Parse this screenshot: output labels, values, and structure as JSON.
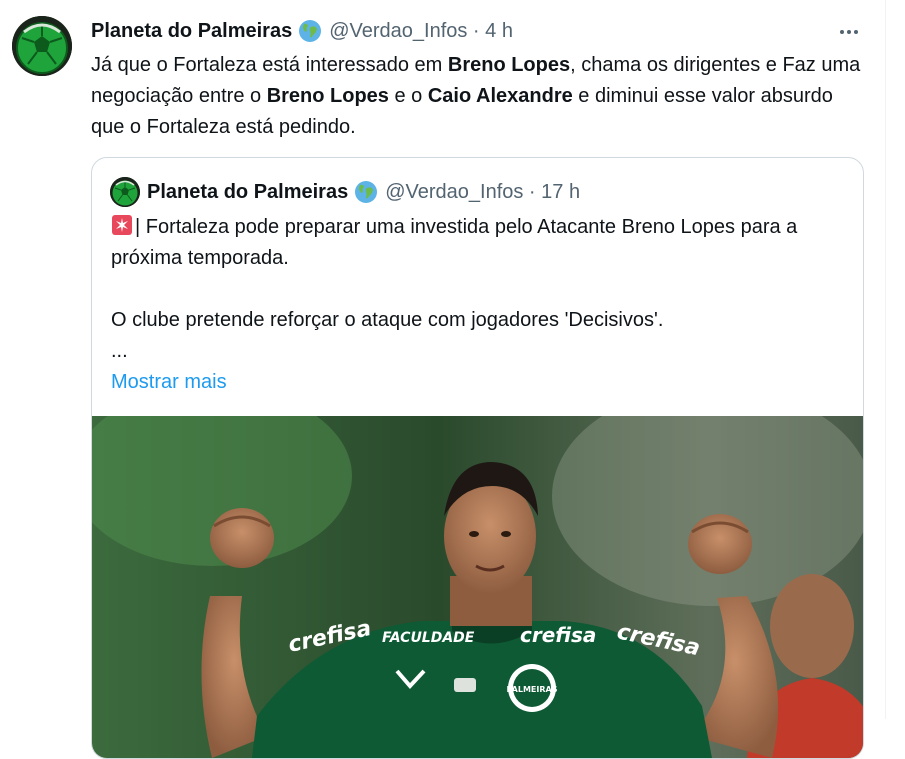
{
  "tweet": {
    "author_name": "Planeta do Palmeiras",
    "handle_time": "@Verdao_Infos · 4 h",
    "text_parts": {
      "p1": "Já que o Fortaleza está interessado em ",
      "b1": "Breno Lopes",
      "p2": ", chama os dirigentes e Faz uma negociação entre o ",
      "b2": "Breno Lopes",
      "p3": " e o ",
      "b3": "Caio Alexandre",
      "p4": " e diminui esse valor absurdo que o Fortaleza está pedindo."
    }
  },
  "quoted": {
    "author_name": "Planeta do Palmeiras",
    "handle_time": "@Verdao_Infos · 17 h",
    "line1": "| Fortaleza pode preparar uma investida pelo Atacante Breno Lopes para a próxima temporada.",
    "line2": "O clube pretende reforçar o ataque com jogadores 'Decisivos'.",
    "ellipsis": "...",
    "show_more": "Mostrar mais",
    "photo": {
      "jersey_text_left": "crefisa",
      "jersey_text_right": "crefisa",
      "jersey_text_center": "crefisa",
      "sponsor_chest": "FACULDADE",
      "crest_text": "PALMEIRAS"
    }
  },
  "icons": {
    "more": "more-dots-icon",
    "globe": "globe-emoji-icon",
    "siren": "rotating-light-icon"
  },
  "colors": {
    "link": "#1d9bf0",
    "secondary_text": "#536471",
    "border": "#cfd9de",
    "jersey": "#0d5a34"
  }
}
